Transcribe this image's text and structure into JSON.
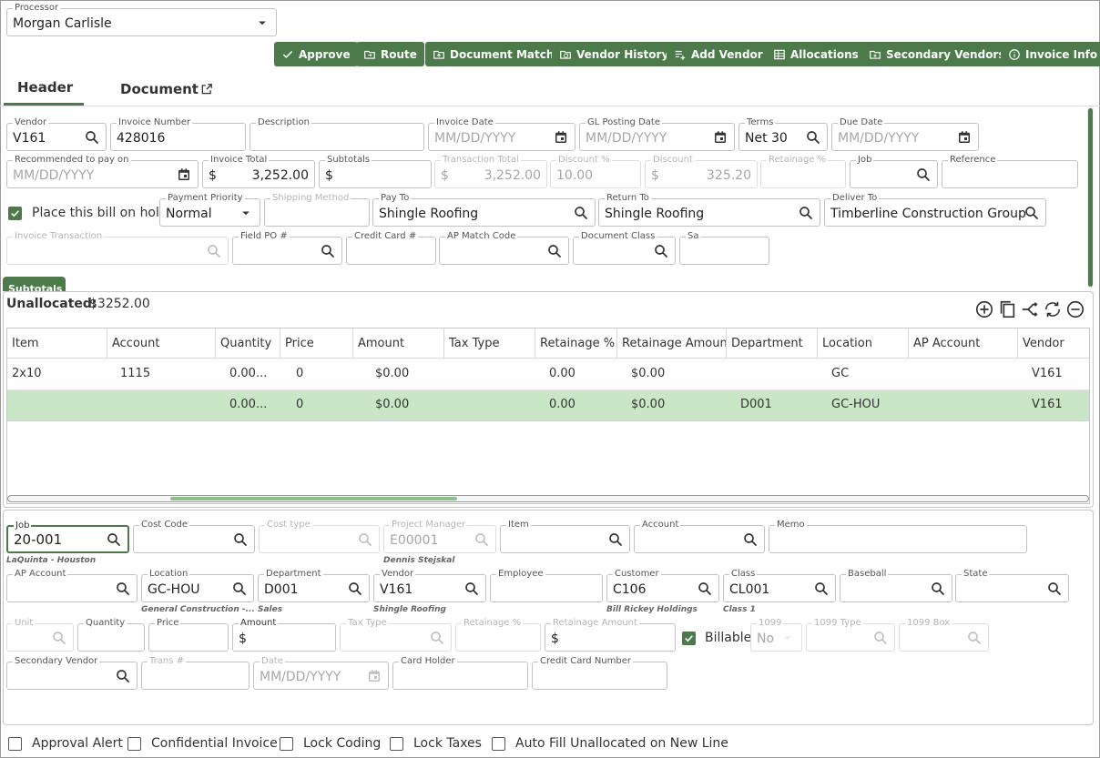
{
  "processor": {
    "label": "Processor",
    "value": "Morgan Carlisle"
  },
  "toolbar": [
    {
      "label": "Approve",
      "icon": "check-icon"
    },
    {
      "label": "Route",
      "icon": "route-folder-icon"
    },
    {
      "label": "Document Match",
      "icon": "upload-folder-icon"
    },
    {
      "label": "Vendor History",
      "icon": "history-folder-icon"
    },
    {
      "label": "Add Vendor",
      "icon": "add-list-icon"
    },
    {
      "label": "Allocations",
      "icon": "table-icon"
    },
    {
      "label": "Secondary Vendors",
      "icon": "add-folder-icon"
    },
    {
      "label": "Invoice Info",
      "icon": "info-icon"
    }
  ],
  "tabs": {
    "header": "Header",
    "document": "Document"
  },
  "header_form": {
    "vendor": {
      "label": "Vendor",
      "value": "V161"
    },
    "invoice_number": {
      "label": "Invoice Number",
      "value": "428016"
    },
    "description": {
      "label": "Description",
      "value": ""
    },
    "invoice_date": {
      "label": "Invoice Date",
      "placeholder": "MM/DD/YYYY"
    },
    "gl_posting_date": {
      "label": "GL Posting Date",
      "placeholder": "MM/DD/YYYY"
    },
    "terms": {
      "label": "Terms",
      "value": "Net 30"
    },
    "due_date": {
      "label": "Due Date",
      "placeholder": "MM/DD/YYYY"
    },
    "recommended_pay": {
      "label": "Recommended to pay on",
      "placeholder": "MM/DD/YYYY"
    },
    "invoice_total": {
      "label": "Invoice Total",
      "prefix": "$",
      "value": "3,252.00"
    },
    "subtotals": {
      "label": "Subtotals",
      "prefix": "$",
      "value": ""
    },
    "transaction_total": {
      "label": "Transaction Total",
      "prefix": "$",
      "value": "3,252.00"
    },
    "discount_pct": {
      "label": "Discount %",
      "value": "10.00"
    },
    "discount": {
      "label": "Discount",
      "prefix": "$",
      "value": "325.20"
    },
    "retainage_pct": {
      "label": "Retainage %",
      "value": ""
    },
    "job": {
      "label": "Job",
      "value": ""
    },
    "reference": {
      "label": "Reference",
      "value": ""
    },
    "hold": {
      "label": "Place this bill on hold",
      "checked": true
    },
    "payment_priority": {
      "label": "Payment Priority",
      "value": "Normal"
    },
    "shipping_method": {
      "label": "Shipping Method",
      "value": ""
    },
    "pay_to": {
      "label": "Pay To",
      "value": "Shingle Roofing"
    },
    "return_to": {
      "label": "Return To",
      "value": "Shingle Roofing"
    },
    "deliver_to": {
      "label": "Deliver To",
      "value": "Timberline Construction Group"
    },
    "invoice_transaction": {
      "label": "Invoice Transaction",
      "value": ""
    },
    "field_po": {
      "label": "Field PO #",
      "value": ""
    },
    "credit_card": {
      "label": "Credit Card #",
      "value": ""
    },
    "ap_match_code": {
      "label": "AP Match Code",
      "value": ""
    },
    "document_class": {
      "label": "Document Class",
      "value": ""
    },
    "sa": {
      "label": "Sa",
      "value": ""
    },
    "subtotals_button": "Subtotals"
  },
  "unallocated": {
    "label": "Unallocated:",
    "value": "$3252.00"
  },
  "grid": {
    "columns": [
      "Item",
      "Account",
      "Quantity",
      "Price",
      "Amount",
      "Tax Type",
      "Retainage %",
      "Retainage Amount",
      "Department",
      "Location",
      "AP Account",
      "Vendor"
    ],
    "rows": [
      [
        "2x10",
        "1115",
        "0.00...",
        "0",
        "$0.00",
        "",
        "0.00",
        "$0.00",
        "",
        "GC",
        "",
        "V161"
      ],
      [
        "",
        "",
        "0.00...",
        "0",
        "$0.00",
        "",
        "0.00",
        "$0.00",
        "D001",
        "GC-HOU",
        "",
        "V161"
      ]
    ],
    "selected_row": 1
  },
  "line_form": {
    "job": {
      "label": "Job",
      "value": "20-001",
      "sub": "LaQuinta - Houston"
    },
    "cost_code": {
      "label": "Cost Code",
      "value": ""
    },
    "cost_type": {
      "label": "Cost type",
      "value": ""
    },
    "project_manager": {
      "label": "Project Manager",
      "value": "E00001",
      "sub": "Dennis Stejskal"
    },
    "item": {
      "label": "Item",
      "value": ""
    },
    "account": {
      "label": "Account",
      "value": ""
    },
    "memo": {
      "label": "Memo",
      "value": ""
    },
    "ap_account": {
      "label": "AP Account",
      "value": ""
    },
    "location": {
      "label": "Location",
      "value": "GC-HOU",
      "sub": "General Construction -..."
    },
    "department": {
      "label": "Department",
      "value": "D001",
      "sub": "Sales"
    },
    "vendor": {
      "label": "Vendor",
      "value": "V161",
      "sub": "Shingle Roofing"
    },
    "employee": {
      "label": "Employee",
      "value": ""
    },
    "customer": {
      "label": "Customer",
      "value": "C106",
      "sub": "Bill Rickey Holdings"
    },
    "class": {
      "label": "Class",
      "value": "CL001",
      "sub": "Class 1"
    },
    "baseball": {
      "label": "Baseball",
      "value": ""
    },
    "state": {
      "label": "State",
      "value": ""
    },
    "unit": {
      "label": "Unit",
      "value": ""
    },
    "quantity": {
      "label": "Quantity",
      "value": ""
    },
    "price": {
      "label": "Price",
      "value": ""
    },
    "amount": {
      "label": "Amount",
      "prefix": "$"
    },
    "tax_type": {
      "label": "Tax Type",
      "value": ""
    },
    "retainage_pct": {
      "label": "Retainage %",
      "value": ""
    },
    "retainage_amount": {
      "label": "Retainage Amount",
      "prefix": "$"
    },
    "billable": {
      "label": "Billable",
      "checked": true
    },
    "n1099": {
      "label": "1099",
      "value": "No"
    },
    "type1099": {
      "label": "1099 Type",
      "value": ""
    },
    "box1099": {
      "label": "1099 Box",
      "value": ""
    },
    "secondary_vendor": {
      "label": "Secondary Vendor",
      "value": ""
    },
    "trans": {
      "label": "Trans #",
      "value": ""
    },
    "date": {
      "label": "Date",
      "placeholder": "MM/DD/YYYY"
    },
    "card_holder": {
      "label": "Card Holder",
      "value": ""
    },
    "credit_card_number": {
      "label": "Credit Card Number",
      "value": ""
    }
  },
  "footer_checks": [
    {
      "label": "Approval Alert",
      "checked": false
    },
    {
      "label": "Confidential Invoice",
      "checked": false
    },
    {
      "label": "Lock Coding",
      "checked": false
    },
    {
      "label": "Lock Taxes",
      "checked": false
    },
    {
      "label": "Auto Fill Unallocated on New Line",
      "checked": false
    }
  ],
  "colors": {
    "accent": "#4c7a4a",
    "selected_row": "#c9e6c7"
  }
}
